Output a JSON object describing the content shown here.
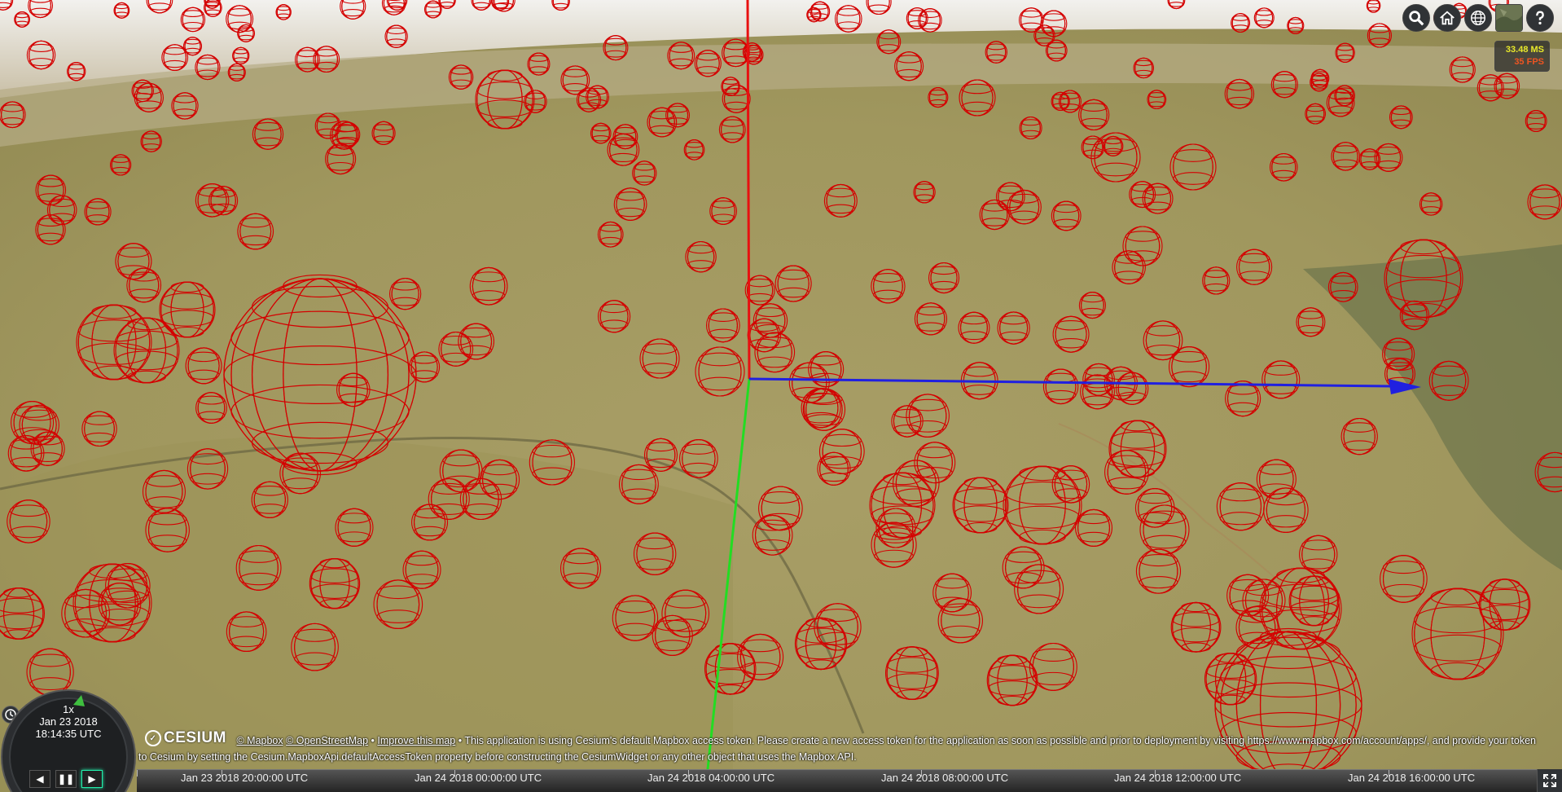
{
  "toolbar": {
    "buttons": [
      {
        "name": "search-icon"
      },
      {
        "name": "home-icon"
      },
      {
        "name": "globe-icon"
      },
      {
        "name": "imagery-picker-icon"
      },
      {
        "name": "help-icon"
      }
    ]
  },
  "performance": {
    "ms": "33.48 MS",
    "fps": "35 FPS"
  },
  "animation": {
    "speed": "1x",
    "date": "Jan 23 2018",
    "time": "18:14:35 UTC"
  },
  "credits": {
    "logo": "CESIUM",
    "mapbox": "© Mapbox",
    "osm": "© OpenStreetMap",
    "improve": "Improve this map",
    "notice": "• This application is using Cesium's default Mapbox access token. Please create a new access token for the application as soon as possible and prior to deployment by visiting https://www.mapbox.com/account/apps/, and provide your token to Cesium by setting the Cesium.MapboxApi.defaultAccessToken property before constructing the CesiumWidget or any other object that uses the Mapbox API."
  },
  "timeline": {
    "labels": [
      "Jan 23 2018 20:00:00 UTC",
      "Jan 24 2018 00:00:00 UTC",
      "Jan 24 2018 04:00:00 UTC",
      "Jan 24 2018 08:00:00 UTC",
      "Jan 24 2018 12:00:00 UTC",
      "Jan 24 2018 16:00:00 UTC"
    ]
  },
  "colors": {
    "sphere": "#d40000",
    "axis_x": "#2020e0",
    "axis_y": "#22dd22",
    "axis_z": "#e01010",
    "terrain": "#a39a63",
    "sky": "#e8e6e0"
  }
}
